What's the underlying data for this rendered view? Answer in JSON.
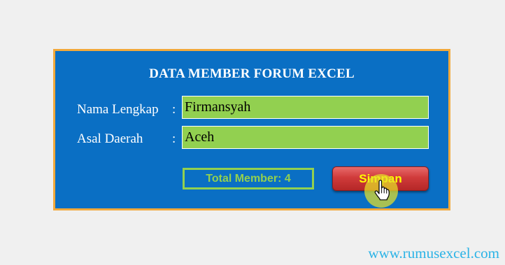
{
  "form": {
    "title": "DATA MEMBER FORUM EXCEL",
    "name_label": "Nama Lengkap",
    "region_label": "Asal Daerah",
    "colon": ":",
    "name_value": "Firmansyah",
    "region_value": "Aceh",
    "total_member": "Total Member: 4",
    "save_label": "Simpan"
  },
  "footer": {
    "website": "www.rumusexcel.com"
  },
  "colors": {
    "panel_background": "#0a6fc4",
    "panel_border": "#f2a93b",
    "input_fill": "#92d050",
    "button_text": "#ffff00",
    "website_text": "#2bb3e6"
  },
  "cursor": {
    "icon": "hand-pointer-icon"
  }
}
